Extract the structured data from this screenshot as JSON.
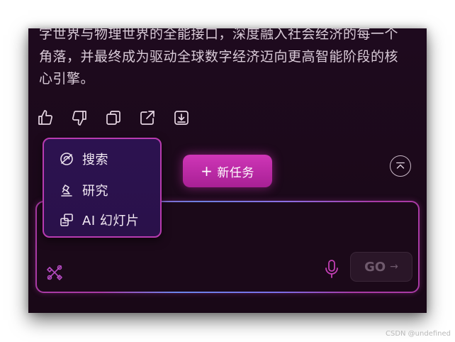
{
  "article": {
    "lines": [
      "字世界与物理世界的全能接口，深度融入社会经济的每一个",
      "角落，并最终成为驱动全球数字经济迈向更高智能阶段的核",
      "心引擎。"
    ]
  },
  "actions": [
    {
      "name": "like",
      "icon": "thumbs-up-icon"
    },
    {
      "name": "dislike",
      "icon": "thumbs-down-icon"
    },
    {
      "name": "copy",
      "icon": "copy-icon"
    },
    {
      "name": "share",
      "icon": "share-icon"
    },
    {
      "name": "download",
      "icon": "download-icon"
    }
  ],
  "new_task": {
    "plus": "+",
    "label": "新任务"
  },
  "collapse": {
    "icon": "chevron-up-icon"
  },
  "menu": {
    "items": [
      {
        "label": "搜索",
        "icon": "search-icon"
      },
      {
        "label": "研究",
        "icon": "microscope-icon"
      },
      {
        "label": "AI 幻灯片",
        "icon": "slides-icon"
      }
    ]
  },
  "composer": {
    "tools_icon": "tools-icon",
    "mic_icon": "mic-icon",
    "go_label": "GO",
    "go_arrow": "→"
  },
  "watermark": "CSDN @undefined",
  "colors": {
    "panel_bg": "#1e0a1e",
    "accent": "#c23fb4",
    "menu_bg": "#2c1250",
    "text": "#d9cbd8"
  }
}
